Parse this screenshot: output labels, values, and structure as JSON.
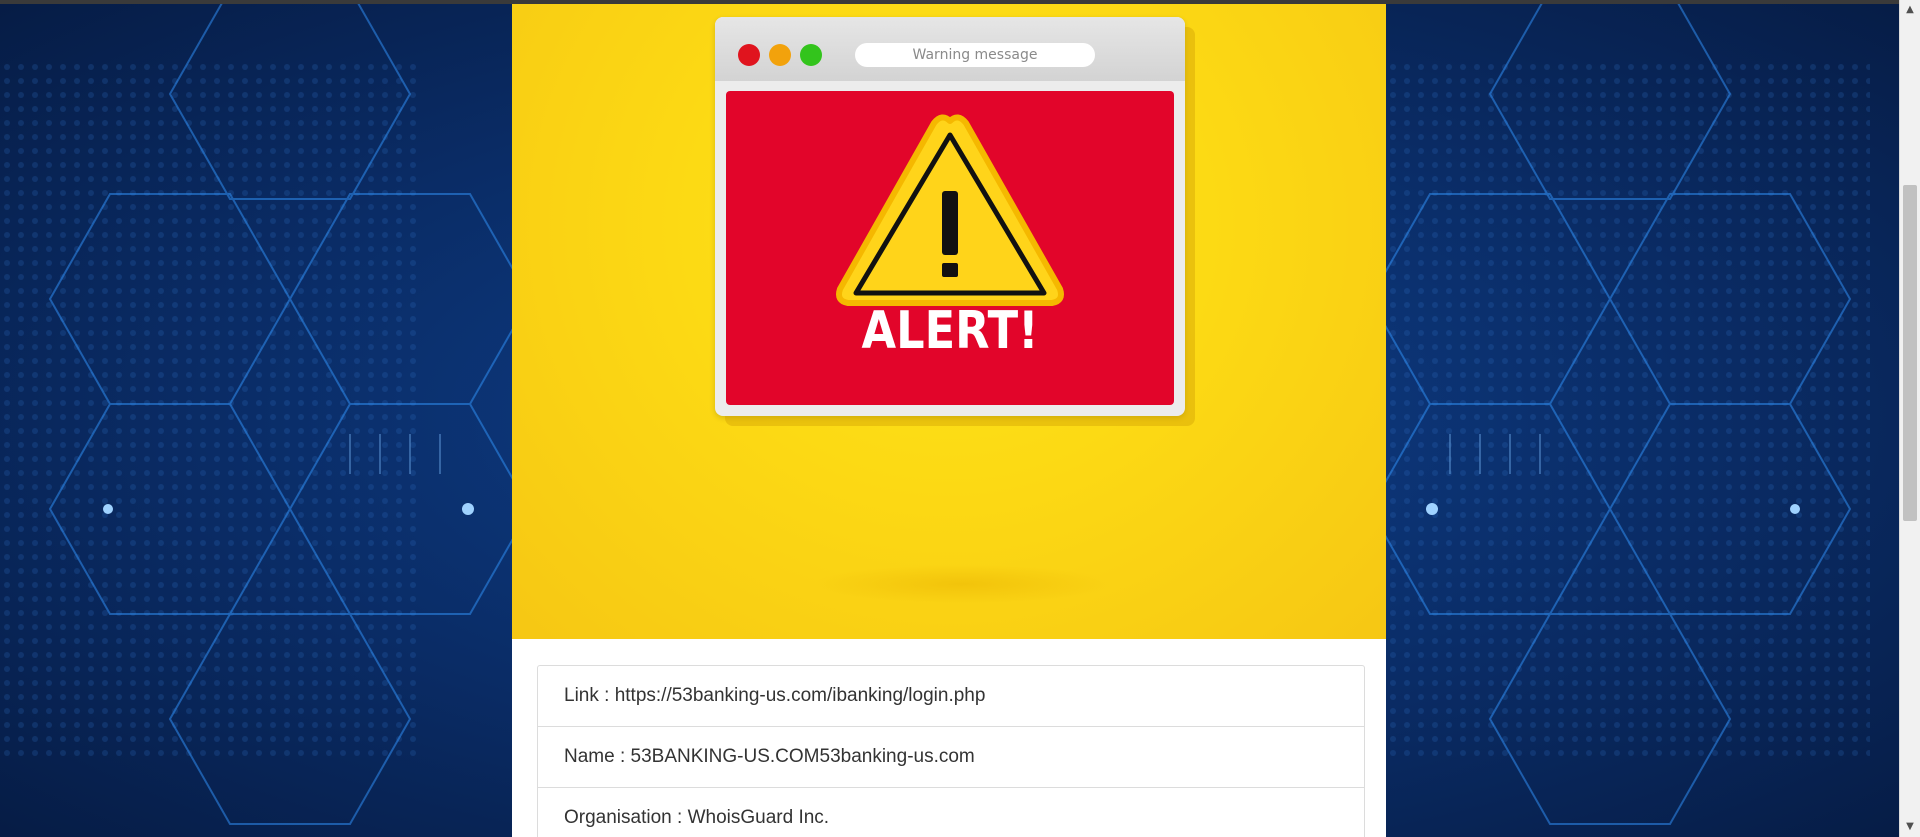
{
  "browser": {
    "scroll_up_glyph": "▲",
    "scroll_down_glyph": "▼"
  },
  "hero": {
    "window_address_text": "Warning message",
    "alert_heading": "ALERT!",
    "icons": [
      "close-dot",
      "minimize-dot",
      "maximize-dot",
      "warning-triangle-icon"
    ]
  },
  "details": {
    "rows": [
      {
        "text": "Link : https://53banking-us.com/ibanking/login.php"
      },
      {
        "text": "Name : 53BANKING-US.COM53banking-us.com"
      },
      {
        "text": "Organisation : WhoisGuard Inc."
      }
    ]
  },
  "colors": {
    "hero_yellow": "#fcd914",
    "alert_red": "#e2052a",
    "background_blue": "#0a2c66"
  }
}
